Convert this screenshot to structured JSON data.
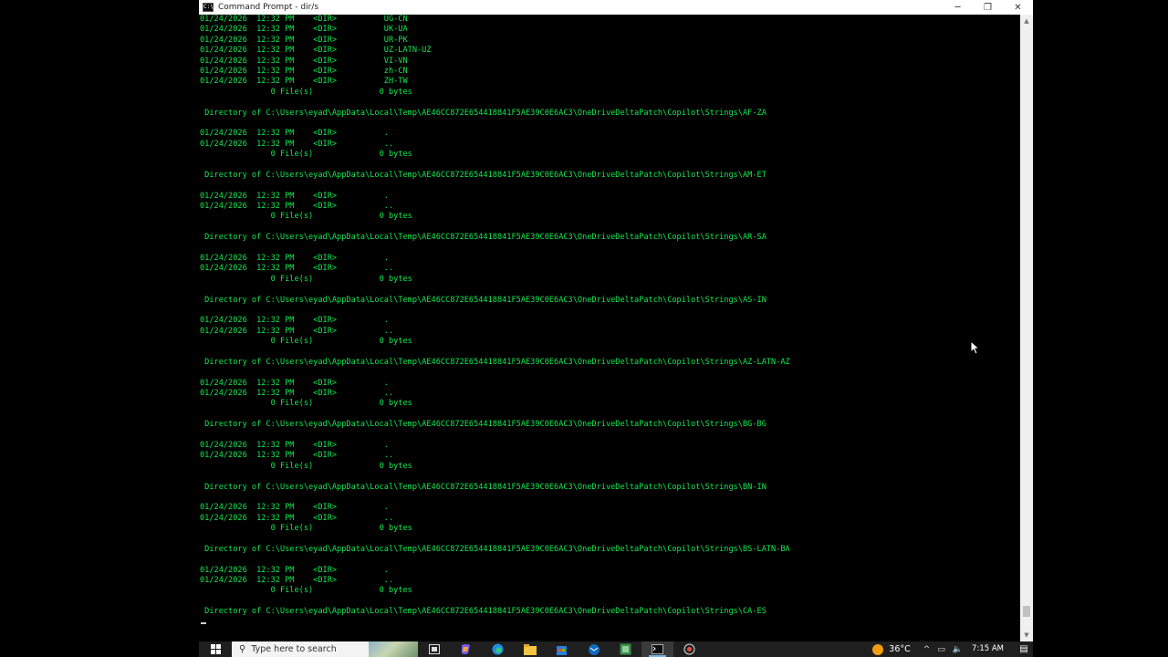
{
  "window": {
    "title": "Command Prompt - dir/s",
    "icon_text": "C:\\",
    "controls": {
      "minimize": "─",
      "maximize": "❐",
      "close": "✕"
    }
  },
  "console": {
    "lines": [
      "01/24/2026  12:32 PM    <DIR>          UG-CN",
      "01/24/2026  12:32 PM    <DIR>          UK-UA",
      "01/24/2026  12:32 PM    <DIR>          UR-PK",
      "01/24/2026  12:32 PM    <DIR>          UZ-LATN-UZ",
      "01/24/2026  12:32 PM    <DIR>          VI-VN",
      "01/24/2026  12:32 PM    <DIR>          zh-CN",
      "01/24/2026  12:32 PM    <DIR>          ZH-TW",
      "               0 File(s)              0 bytes",
      "",
      " Directory of C:\\Users\\eyad\\AppData\\Local\\Temp\\AE46CC872E654418841F5AE39C0E6AC3\\OneDriveDeltaPatch\\Copilot\\Strings\\AF-ZA",
      "",
      "01/24/2026  12:32 PM    <DIR>          .",
      "01/24/2026  12:32 PM    <DIR>          ..",
      "               0 File(s)              0 bytes",
      "",
      " Directory of C:\\Users\\eyad\\AppData\\Local\\Temp\\AE46CC872E654418841F5AE39C0E6AC3\\OneDriveDeltaPatch\\Copilot\\Strings\\AM-ET",
      "",
      "01/24/2026  12:32 PM    <DIR>          .",
      "01/24/2026  12:32 PM    <DIR>          ..",
      "               0 File(s)              0 bytes",
      "",
      " Directory of C:\\Users\\eyad\\AppData\\Local\\Temp\\AE46CC872E654418841F5AE39C0E6AC3\\OneDriveDeltaPatch\\Copilot\\Strings\\AR-SA",
      "",
      "01/24/2026  12:32 PM    <DIR>          .",
      "01/24/2026  12:32 PM    <DIR>          ..",
      "               0 File(s)              0 bytes",
      "",
      " Directory of C:\\Users\\eyad\\AppData\\Local\\Temp\\AE46CC872E654418841F5AE39C0E6AC3\\OneDriveDeltaPatch\\Copilot\\Strings\\AS-IN",
      "",
      "01/24/2026  12:32 PM    <DIR>          .",
      "01/24/2026  12:32 PM    <DIR>          ..",
      "               0 File(s)              0 bytes",
      "",
      " Directory of C:\\Users\\eyad\\AppData\\Local\\Temp\\AE46CC872E654418841F5AE39C0E6AC3\\OneDriveDeltaPatch\\Copilot\\Strings\\AZ-LATN-AZ",
      "",
      "01/24/2026  12:32 PM    <DIR>          .",
      "01/24/2026  12:32 PM    <DIR>          ..",
      "               0 File(s)              0 bytes",
      "",
      " Directory of C:\\Users\\eyad\\AppData\\Local\\Temp\\AE46CC872E654418841F5AE39C0E6AC3\\OneDriveDeltaPatch\\Copilot\\Strings\\BG-BG",
      "",
      "01/24/2026  12:32 PM    <DIR>          .",
      "01/24/2026  12:32 PM    <DIR>          ..",
      "               0 File(s)              0 bytes",
      "",
      " Directory of C:\\Users\\eyad\\AppData\\Local\\Temp\\AE46CC872E654418841F5AE39C0E6AC3\\OneDriveDeltaPatch\\Copilot\\Strings\\BN-IN",
      "",
      "01/24/2026  12:32 PM    <DIR>          .",
      "01/24/2026  12:32 PM    <DIR>          ..",
      "               0 File(s)              0 bytes",
      "",
      " Directory of C:\\Users\\eyad\\AppData\\Local\\Temp\\AE46CC872E654418841F5AE39C0E6AC3\\OneDriveDeltaPatch\\Copilot\\Strings\\BS-LATN-BA",
      "",
      "01/24/2026  12:32 PM    <DIR>          .",
      "01/24/2026  12:32 PM    <DIR>          ..",
      "               0 File(s)              0 bytes",
      "",
      " Directory of C:\\Users\\eyad\\AppData\\Local\\Temp\\AE46CC872E654418841F5AE39C0E6AC3\\OneDriveDeltaPatch\\Copilot\\Strings\\CA-ES"
    ],
    "text_color": "#13e84f",
    "background": "#000000"
  },
  "taskbar": {
    "search_placeholder": "Type here to search",
    "apps": [
      "task-view-icon",
      "copilot-icon",
      "edge-icon",
      "file-explorer-icon",
      "store-icon",
      "mail-icon",
      "app-icon",
      "command-prompt-icon",
      "recorder-icon"
    ],
    "weather": {
      "temp": "36°C"
    },
    "clock": {
      "time": "7:15 AM",
      "date": ""
    }
  }
}
